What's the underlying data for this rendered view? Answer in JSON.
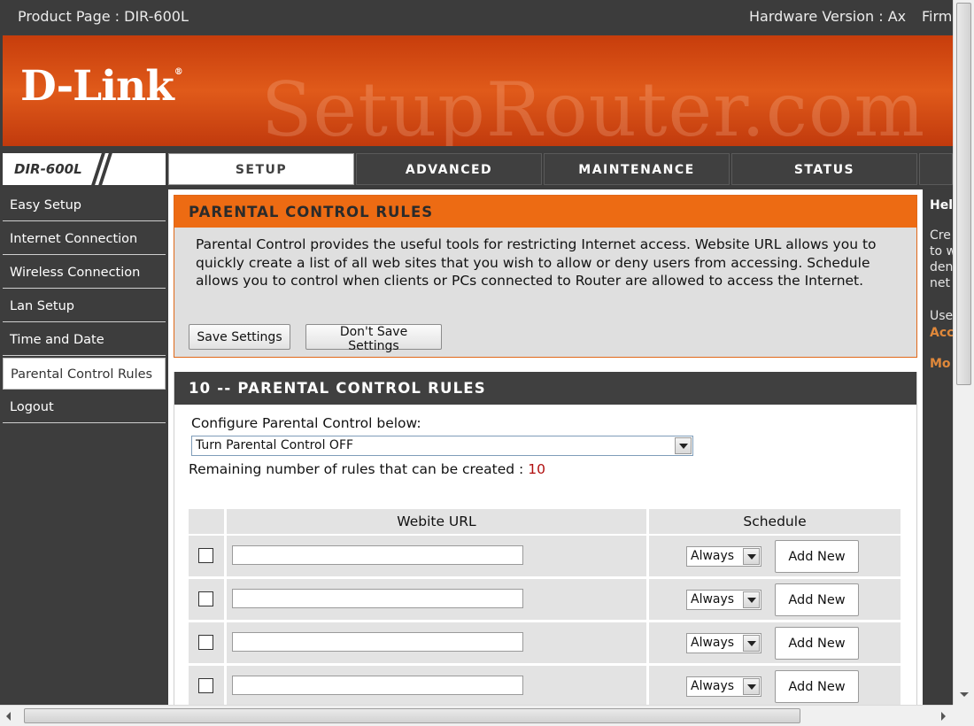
{
  "topbar": {
    "product": "Product Page : DIR-600L",
    "hardware": "Hardware Version : Ax",
    "firmware": "Firm"
  },
  "banner": {
    "logo": "D-Link",
    "logo_mark": "®",
    "watermark": "SetupRouter.com"
  },
  "nav": {
    "model": "DIR-600L",
    "tabs": [
      {
        "label": "SETUP",
        "active": true
      },
      {
        "label": "ADVANCED"
      },
      {
        "label": "MAINTENANCE"
      },
      {
        "label": "STATUS"
      }
    ]
  },
  "sidebar": {
    "items": [
      {
        "label": "Easy Setup"
      },
      {
        "label": "Internet Connection"
      },
      {
        "label": "Wireless Connection"
      },
      {
        "label": "Lan Setup"
      },
      {
        "label": "Time and Date"
      },
      {
        "label": "Parental Control Rules",
        "active": true
      },
      {
        "label": "Logout"
      }
    ]
  },
  "intro": {
    "title": "PARENTAL CONTROL RULES",
    "text": "Parental Control provides the useful tools for restricting Internet access. Website URL allows you to quickly create a list of all web sites that you wish to allow or deny users from accessing. Schedule allows you to control when clients or PCs connected to Router are allowed to access the Internet.",
    "save_label": "Save Settings",
    "dont_save_label": "Don't Save Settings"
  },
  "rules": {
    "title": "10 -- PARENTAL CONTROL RULES",
    "config_label": "Configure Parental Control below:",
    "select_value": "Turn Parental Control OFF",
    "remaining_label": "Remaining number of rules that can be created :",
    "remaining_count": "10",
    "col_url": "Webite URL",
    "col_schedule": "Schedule",
    "rows": [
      {
        "schedule": "Always",
        "button": "Add New"
      },
      {
        "schedule": "Always",
        "button": "Add New"
      },
      {
        "schedule": "Always",
        "button": "Add New"
      },
      {
        "schedule": "Always",
        "button": "Add New"
      }
    ]
  },
  "help": {
    "title": "Hel",
    "lines": [
      "Cre",
      "to w",
      "den",
      "net"
    ],
    "use": "Use",
    "link1": "Acc",
    "link2": "Mo"
  },
  "colors": {
    "accent_orange": "#ed6b13",
    "dark_gray": "#3c3c3c",
    "count_red": "#b00e0e"
  },
  "icons": {
    "dropdown": "chevron-down-icon",
    "scroll_up": "arrow-up-icon",
    "scroll_down": "arrow-down-icon",
    "scroll_left": "arrow-left-icon",
    "scroll_right": "arrow-right-icon"
  }
}
